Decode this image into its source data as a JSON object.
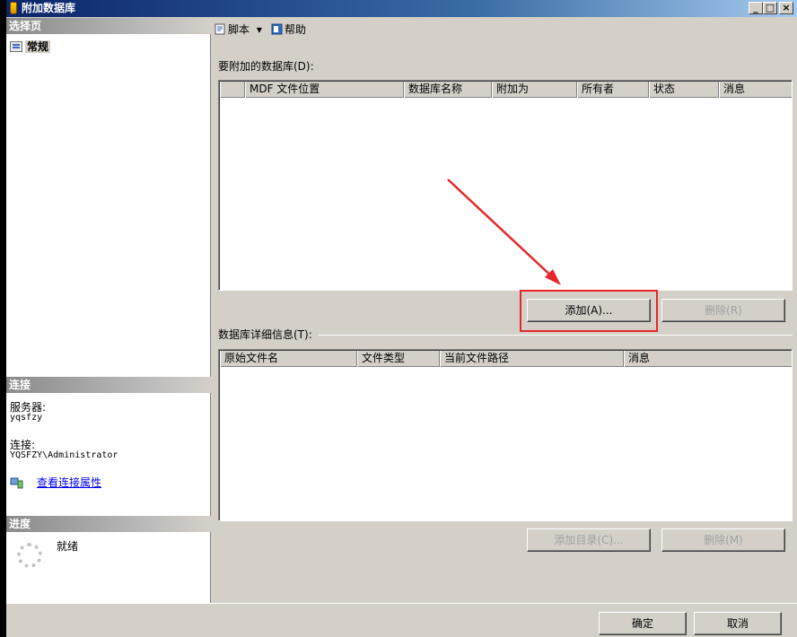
{
  "window": {
    "title": "附加数据库",
    "controls": {
      "minimize": "_",
      "maximize": "□",
      "close": "×"
    }
  },
  "left": {
    "pages_header": "选择页",
    "pages": [
      {
        "label": "常规",
        "icon": "general-page-icon"
      }
    ],
    "connection_header": "连接",
    "server_label": "服务器:",
    "server_value": "yqsfzy",
    "connection_label": "连接:",
    "connection_value": "YQSFZY\\Administrator",
    "view_props_link": "查看连接属性",
    "progress_header": "进度",
    "progress_status": "就绪"
  },
  "toolbar": {
    "script_label": "脚本",
    "script_dropdown": "▾",
    "help_label": "帮助"
  },
  "attach": {
    "group_label": "要附加的数据库(D):",
    "columns": [
      "",
      "MDF 文件位置",
      "数据库名称",
      "附加为",
      "所有者",
      "状态",
      "消息"
    ],
    "rows": [],
    "add_button": "添加(A)...",
    "remove_button": "删除(R)"
  },
  "details": {
    "group_label": "数据库详细信息(T):",
    "columns": [
      "原始文件名",
      "文件类型",
      "当前文件路径",
      "消息"
    ],
    "rows": [],
    "add_catalog_button": "添加目录(C)...",
    "remove_button": "删除(M)"
  },
  "footer": {
    "ok_button": "确定",
    "cancel_button": "取消"
  },
  "annotation": {
    "highlight_color": "#e8262a"
  }
}
